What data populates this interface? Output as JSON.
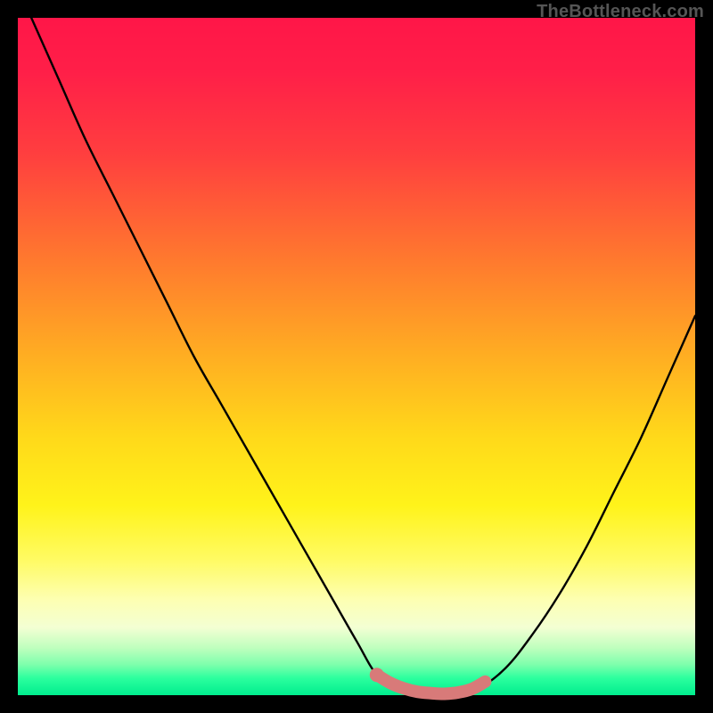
{
  "watermark": "TheBottleneck.com",
  "chart_data": {
    "type": "line",
    "title": "",
    "xlabel": "",
    "ylabel": "",
    "xlim": [
      0,
      100
    ],
    "ylim": [
      0,
      100
    ],
    "series": [
      {
        "name": "bottleneck-curve",
        "x": [
          2,
          6,
          10,
          14,
          18,
          22,
          26,
          30,
          34,
          38,
          42,
          46,
          50,
          53,
          56,
          60,
          64,
          68,
          72,
          76,
          80,
          84,
          88,
          92,
          96,
          100
        ],
        "values": [
          100,
          91,
          82,
          74,
          66,
          58,
          50,
          43,
          36,
          29,
          22,
          15,
          8,
          3,
          1,
          0,
          0,
          1,
          4,
          9,
          15,
          22,
          30,
          38,
          47,
          56
        ]
      }
    ],
    "highlight": {
      "name": "sweet-spot",
      "x": [
        53,
        55,
        57,
        59,
        61,
        63,
        65,
        67,
        69
      ],
      "values": [
        3,
        1.8,
        1,
        0.5,
        0.3,
        0.2,
        0.4,
        0.9,
        2
      ]
    },
    "colors": {
      "curve": "#000000",
      "highlight": "#d87a79",
      "gradient_top": "#ff1648",
      "gradient_mid": "#ffd91a",
      "gradient_bottom": "#00ed8e"
    }
  }
}
